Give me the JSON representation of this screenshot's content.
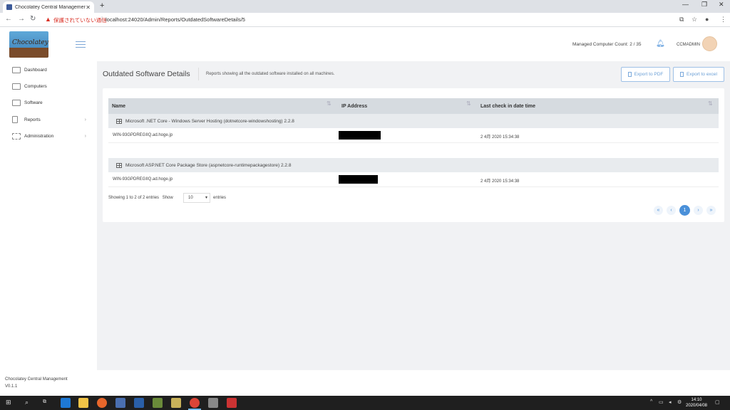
{
  "browser": {
    "tab_title": "Chocolatey Central Management",
    "tab_close": "✕",
    "new_tab": "+",
    "security_text": "保護されていない通信",
    "url": "localhost:24020/Admin/Reports/OutdatedSoftwareDetails/5"
  },
  "header": {
    "logo_text": "Chocolatey",
    "managed_count": "Managed Computer Count: 2 / 35",
    "username": "CCMADMIN"
  },
  "sidebar": {
    "items": [
      {
        "label": "Dashboard",
        "icon": "dashboard-icon"
      },
      {
        "label": "Computers",
        "icon": "monitor-icon"
      },
      {
        "label": "Software",
        "icon": "grid-icon"
      },
      {
        "label": "Reports",
        "icon": "report-icon",
        "chevron": "›"
      },
      {
        "label": "Administration",
        "icon": "sliders-icon",
        "chevron": "›"
      }
    ]
  },
  "page": {
    "title": "Outdated Software Details",
    "description": "Reports showing all the outdated software installed on all machines.",
    "export_pdf": "Export to PDF",
    "export_excel": "Export to excel"
  },
  "table": {
    "columns": [
      "Name",
      "IP Address",
      "Last check in date time"
    ],
    "groups": [
      {
        "name": "Microsoft .NET Core - Windows Server Hosting (dotnetcore-windowshosting) 2.2.8",
        "rows": [
          {
            "name": "WIN-93GPDREGIIQ.ad.hoge.jp",
            "ip": "",
            "last_checkin": "2 4月 2020 15:34:38"
          }
        ]
      },
      {
        "name": "Microsoft ASP.NET Core Package Store (aspnetcore-runtimepackagestore) 2.2.8",
        "rows": [
          {
            "name": "WIN-93GPDREGIIQ.ad.hoge.jp",
            "ip": "",
            "last_checkin": "2 4月 2020 15:34:38"
          }
        ]
      }
    ],
    "showing": "Showing 1 to 2 of 2 entries",
    "show_label": "Show",
    "page_length": "10",
    "entries_label": "entries",
    "pagination": {
      "first": "«",
      "prev": "‹",
      "current": "1",
      "next": "›",
      "last": "»"
    }
  },
  "footer": {
    "app_name": "Chocolatey Central Management",
    "version": "V0.1.1"
  },
  "taskbar": {
    "time": "14:10",
    "date": "2020/04/08"
  },
  "colors": {
    "accent": "#4a90d9",
    "background": "#f1f2f4",
    "table_header": "#d6dbe0"
  }
}
